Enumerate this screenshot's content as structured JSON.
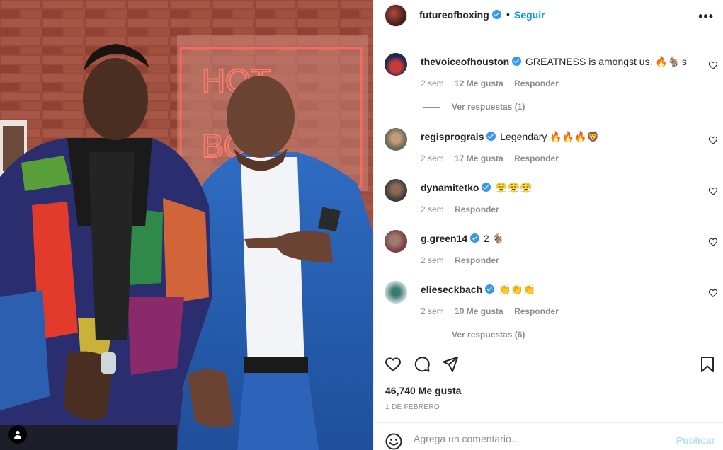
{
  "post": {
    "author": "futureofboxing",
    "separator": "•",
    "follow_label": "Seguir",
    "more_label": "•••"
  },
  "comments": [
    {
      "user": "thevoiceofhouston",
      "verified": true,
      "text": "GREATNESS is amongst us. 🔥🐐's",
      "time": "2 sem",
      "likes": "12 Me gusta",
      "reply": "Responder",
      "view_replies": "Ver respuestas (1)"
    },
    {
      "user": "regisprograis",
      "verified": true,
      "text": "Legendary 🔥🔥🔥🦁",
      "time": "2 sem",
      "likes": "17 Me gusta",
      "reply": "Responder"
    },
    {
      "user": "dynamitetko",
      "verified": true,
      "text": "😤😤😤",
      "time": "2 sem",
      "reply": "Responder"
    },
    {
      "user": "g.green14",
      "verified": true,
      "text": "2 🐐",
      "time": "2 sem",
      "reply": "Responder"
    },
    {
      "user": "elieseckbach",
      "verified": true,
      "text": "👏👏👏",
      "time": "2 sem",
      "likes": "10 Me gusta",
      "reply": "Responder",
      "view_replies": "Ver respuestas (6)"
    }
  ],
  "actions": {
    "icons": [
      "heart-icon",
      "comment-icon",
      "share-icon",
      "bookmark-icon"
    ],
    "likes_count": "46,740 Me gusta",
    "date": "1 DE FEBRERO"
  },
  "add_comment": {
    "placeholder": "Agrega un comentario...",
    "publish_label": "Publicar"
  },
  "colors": {
    "link_blue": "#0095f6",
    "verified_blue": "#3897f0",
    "muted_text": "#8e8e8e",
    "publish_disabled": "#b2dffc"
  }
}
